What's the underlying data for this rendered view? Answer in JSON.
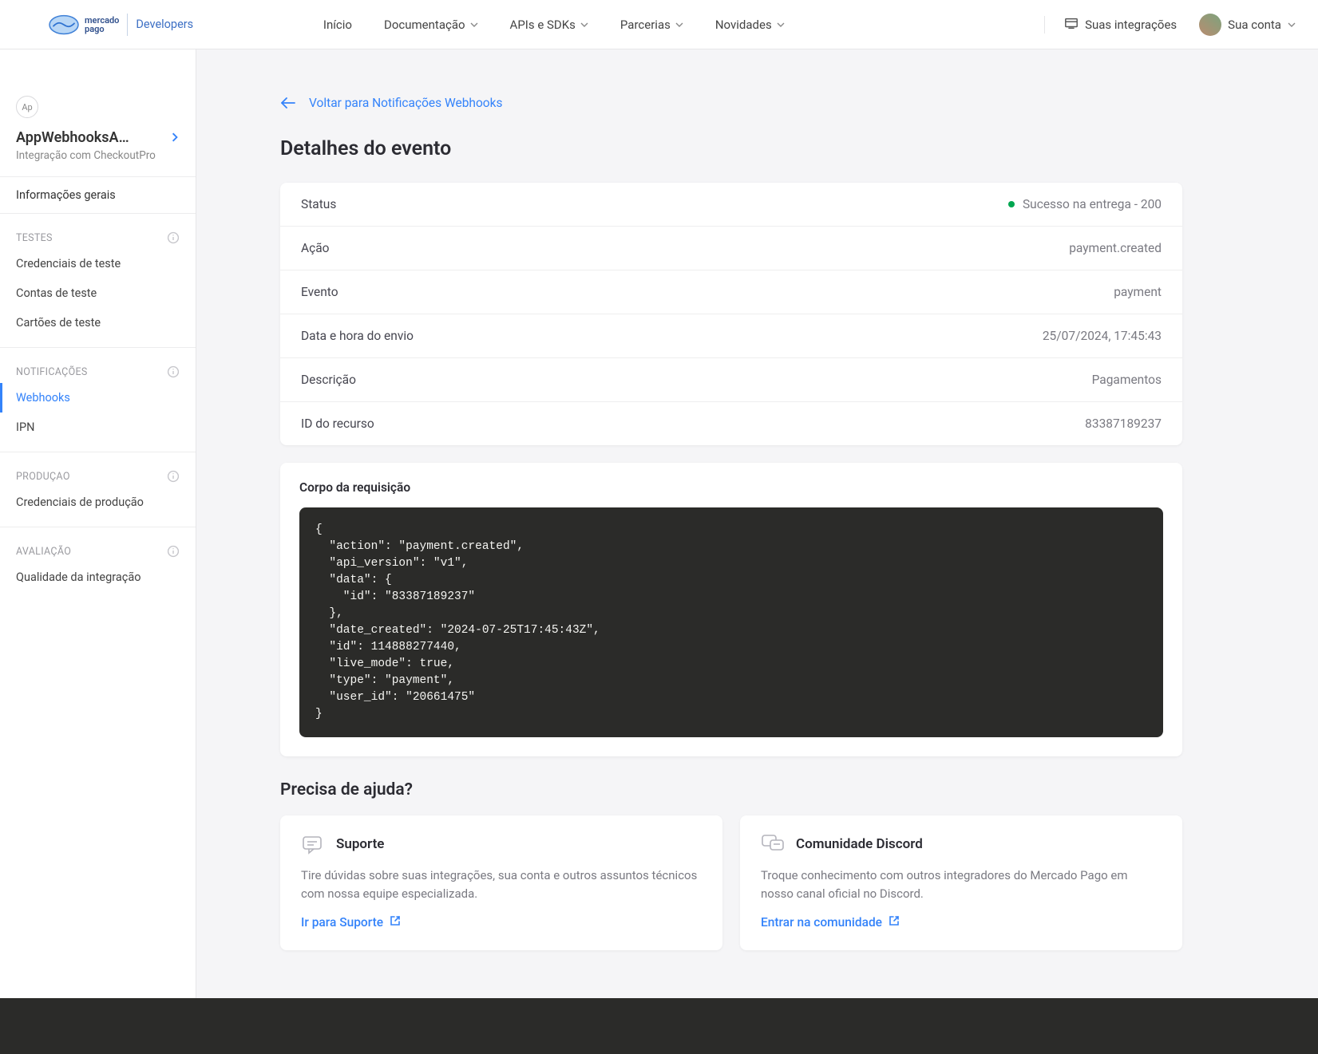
{
  "header": {
    "brand_top": "mercado",
    "brand_bottom": "pago",
    "developers": "Developers",
    "nav": {
      "home": "Início",
      "docs": "Documentação",
      "apis": "APIs e SDKs",
      "partners": "Parcerias",
      "news": "Novidades"
    },
    "integrations": "Suas integrações",
    "account": "Sua conta"
  },
  "sidebar": {
    "app_badge": "Ap",
    "app_title": "AppWebhooksA…",
    "app_sub": "Integração com CheckoutPro",
    "general": "Informações gerais",
    "sections": {
      "tests": {
        "header": "TESTES",
        "items": {
          "creds": "Credenciais de teste",
          "accounts": "Contas de teste",
          "cards": "Cartões de teste"
        }
      },
      "notifications": {
        "header": "NOTIFICAÇÕES",
        "items": {
          "webhooks": "Webhooks",
          "ipn": "IPN"
        }
      },
      "production": {
        "header": "PRODUÇAO",
        "items": {
          "creds": "Credenciais de produção"
        }
      },
      "evaluation": {
        "header": "AVALIAÇÃO",
        "items": {
          "quality": "Qualidade da integração"
        }
      }
    }
  },
  "main": {
    "back": "Voltar para Notificações Webhooks",
    "title": "Detalhes do evento",
    "details": {
      "status_label": "Status",
      "status_value": "Sucesso na entrega - 200",
      "action_label": "Ação",
      "action_value": "payment.created",
      "event_label": "Evento",
      "event_value": "payment",
      "datetime_label": "Data e hora do envio",
      "datetime_value": "25/07/2024, 17:45:43",
      "description_label": "Descrição",
      "description_value": "Pagamentos",
      "resource_label": "ID do recurso",
      "resource_value": "83387189237"
    },
    "body": {
      "title": "Corpo da requisição",
      "code": "{\n  \"action\": \"payment.created\",\n  \"api_version\": \"v1\",\n  \"data\": {\n    \"id\": \"83387189237\"\n  },\n  \"date_created\": \"2024-07-25T17:45:43Z\",\n  \"id\": 114888277440,\n  \"live_mode\": true,\n  \"type\": \"payment\",\n  \"user_id\": \"20661475\"\n}"
    },
    "help": {
      "title": "Precisa de ajuda?",
      "support": {
        "title": "Suporte",
        "desc": "Tire dúvidas sobre suas integrações, sua conta e outros assuntos técnicos com nossa equipe especializada.",
        "link": "Ir para Suporte"
      },
      "discord": {
        "title": "Comunidade Discord",
        "desc": "Troque conhecimento com outros integradores do Mercado Pago em nosso canal oficial no Discord.",
        "link": "Entrar na comunidade"
      }
    }
  }
}
